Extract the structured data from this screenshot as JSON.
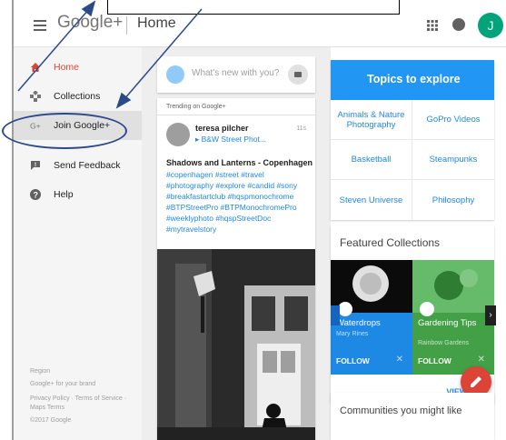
{
  "header": {
    "logo": "Google+",
    "page_name": "Home",
    "avatar_initial": "J"
  },
  "sidebar": {
    "items": [
      {
        "label": "Home",
        "icon": "home-icon"
      },
      {
        "label": "Collections",
        "icon": "collections-icon"
      },
      {
        "label": "Join Google+",
        "icon": "google-plus-icon"
      },
      {
        "label": "Send Feedback",
        "icon": "feedback-icon"
      },
      {
        "label": "Help",
        "icon": "help-icon"
      }
    ],
    "footer": {
      "region": "Region",
      "brand": "Google+ for your brand",
      "policy": "Privacy Policy · Terms of Service ·",
      "maps": "Maps Terms",
      "copyright": "©2017 Google"
    }
  },
  "composer": {
    "placeholder": "What's new with you?"
  },
  "post": {
    "trending_label": "Trending on Google+",
    "author": "teresa pilcher",
    "collection": "▸ B&W Street Phot...",
    "time": "11s",
    "title": "Shadows and Lanterns  - Copenhagen",
    "tags": "#copenhagen #street #travel #photography #explore #candid #sony #breakfastartclub #hqspmonochrome #BTPStreetPro #BTPMonochromePro #weeklyphoto #hqspStreetDoc #mytravelstory"
  },
  "topics": {
    "title": "Topics to explore",
    "items": [
      "Animals & Nature Photography",
      "GoPro Videos",
      "Basketball",
      "Steampunks",
      "Steven Universe",
      "Philosophy"
    ]
  },
  "featured": {
    "title": "Featured Collections",
    "cards": [
      {
        "name": "Waterdrops",
        "owner": "Mary Rines",
        "follow": "FOLLOW",
        "color": "#1e88e5"
      },
      {
        "name": "Gardening Tips",
        "owner": "Rainbow Gardens",
        "follow": "FOLLOW",
        "color": "#43a047"
      }
    ],
    "view_all": "VIEW ALL"
  },
  "communities": {
    "title": "Communities you might like"
  },
  "colors": {
    "accent_red": "#db4437",
    "link_blue": "#1e88e5",
    "topics_blue": "#2196f3",
    "annotation": "#2b4a8a"
  }
}
